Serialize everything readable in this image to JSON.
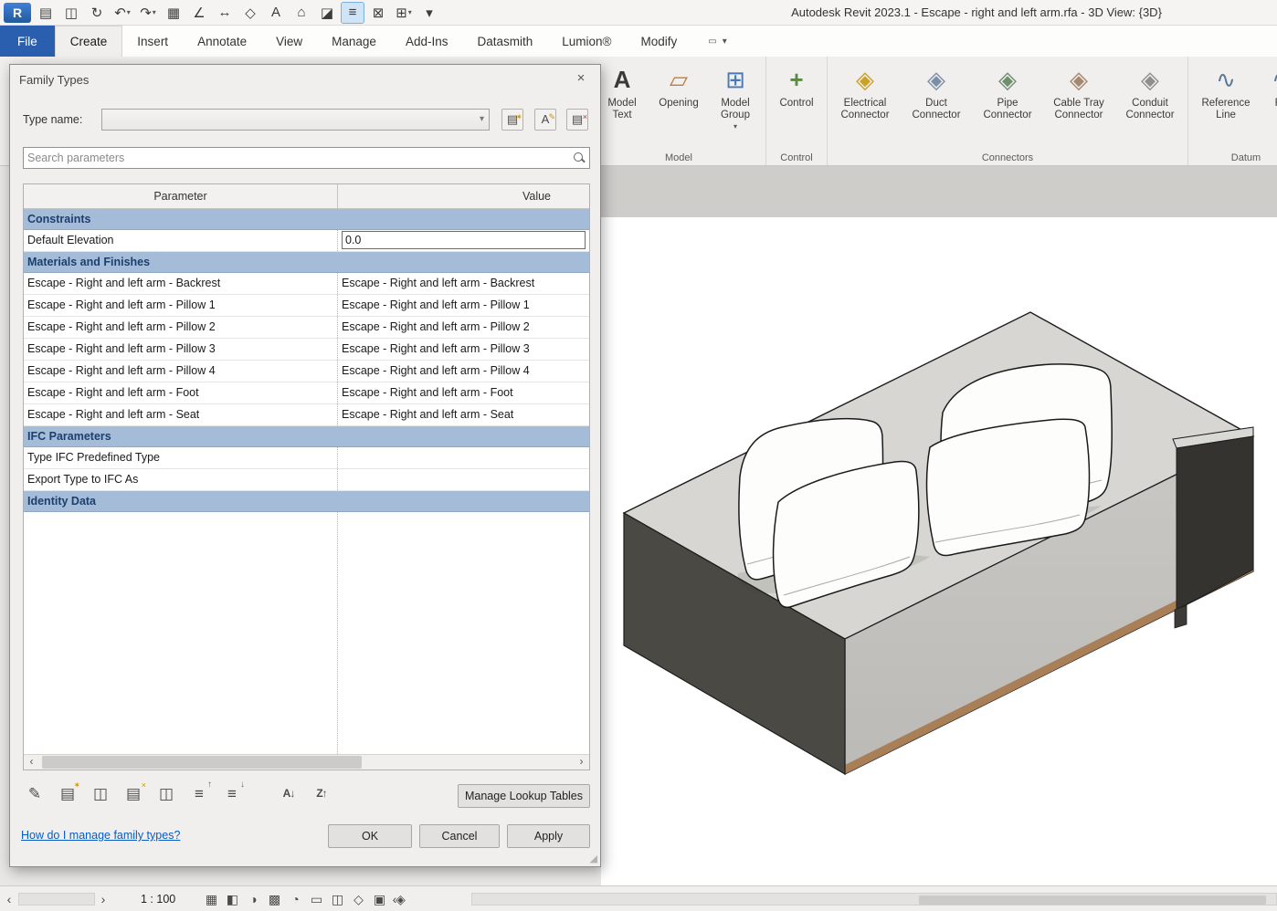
{
  "glyphs": {
    "caret": "▾",
    "chevron_left": "‹",
    "chevron_right": "›",
    "close": "×",
    "grip": "◢",
    "panel_toggle": "▭"
  },
  "title_bar": {
    "title": "Autodesk Revit 2023.1 - Escape - right and left arm.rfa - 3D View: {3D}"
  },
  "qat": {
    "items": [
      {
        "name": "revit-logo",
        "glyph": "R"
      },
      {
        "name": "open",
        "glyph": "▤"
      },
      {
        "name": "save",
        "glyph": "◫"
      },
      {
        "name": "sync",
        "glyph": "↻"
      },
      {
        "name": "undo",
        "glyph": "↶"
      },
      {
        "name": "redo",
        "glyph": "↷"
      },
      {
        "name": "print",
        "glyph": "▦"
      },
      {
        "name": "measure",
        "glyph": "∠"
      },
      {
        "name": "aligned-dimension",
        "glyph": "↔"
      },
      {
        "name": "tag",
        "glyph": "◇"
      },
      {
        "name": "text",
        "glyph": "A"
      },
      {
        "name": "default-3d-view",
        "glyph": "⌂"
      },
      {
        "name": "section",
        "glyph": "◪"
      },
      {
        "name": "thin-lines",
        "glyph": "≡"
      },
      {
        "name": "close-hidden-windows",
        "glyph": "⊠"
      },
      {
        "name": "switch-windows",
        "glyph": "⊞"
      },
      {
        "name": "customize-qat",
        "glyph": "▾"
      }
    ]
  },
  "ribbon": {
    "tabs": [
      "File",
      "Create",
      "Insert",
      "Annotate",
      "View",
      "Manage",
      "Add-Ins",
      "Datasmith",
      "Lumion®",
      "Modify"
    ],
    "active_tab": "Create",
    "panels": [
      {
        "label": "Model",
        "buttons": [
          {
            "label": "Model\nText",
            "icon": "A"
          },
          {
            "label": "Opening",
            "icon": "▱"
          },
          {
            "label": "Model\nGroup",
            "icon": "⊞"
          }
        ]
      },
      {
        "label": "Control",
        "buttons": [
          {
            "label": "Control",
            "icon": "+"
          }
        ]
      },
      {
        "label": "Connectors",
        "buttons": [
          {
            "label": "Electrical\nConnector",
            "icon": "◈"
          },
          {
            "label": "Duct\nConnector",
            "icon": "◈"
          },
          {
            "label": "Pipe\nConnector",
            "icon": "◈"
          },
          {
            "label": "Cable Tray\nConnector",
            "icon": "◈"
          },
          {
            "label": "Conduit\nConnector",
            "icon": "◈"
          }
        ]
      },
      {
        "label": "Datum",
        "buttons": [
          {
            "label": "Reference\nLine",
            "icon": "∿"
          },
          {
            "label": "Re",
            "icon": "∿"
          }
        ]
      }
    ]
  },
  "dialog": {
    "title": "Family Types",
    "type_name_label": "Type name:",
    "type_name_value": "",
    "type_buttons": [
      {
        "name": "new-type",
        "glyph": "▤",
        "overlay": "✶"
      },
      {
        "name": "rename-type",
        "glyph": "A",
        "overlay": "✎"
      },
      {
        "name": "delete-type",
        "glyph": "▤",
        "overlay": "×"
      }
    ],
    "search_placeholder": "Search parameters",
    "table": {
      "param_header": "Parameter",
      "value_header": "Value",
      "rows": [
        {
          "type": "group",
          "parameter": "Constraints"
        },
        {
          "type": "input",
          "parameter": "Default Elevation",
          "value": "0.0"
        },
        {
          "type": "group",
          "parameter": "Materials and Finishes"
        },
        {
          "type": "text",
          "parameter": "Escape - Right and left arm - Backrest",
          "value": "Escape - Right and left arm - Backrest"
        },
        {
          "type": "text",
          "parameter": "Escape - Right and left arm - Pillow 1",
          "value": "Escape - Right and left arm - Pillow 1"
        },
        {
          "type": "text",
          "parameter": "Escape - Right and left arm - Pillow 2",
          "value": "Escape - Right and left arm - Pillow 2"
        },
        {
          "type": "text",
          "parameter": "Escape - Right and left arm - Pillow 3",
          "value": "Escape - Right and left arm - Pillow 3"
        },
        {
          "type": "text",
          "parameter": "Escape - Right and left arm - Pillow 4",
          "value": "Escape - Right and left arm - Pillow 4"
        },
        {
          "type": "text",
          "parameter": "Escape - Right and left arm - Foot",
          "value": "Escape - Right and left arm - Foot"
        },
        {
          "type": "text",
          "parameter": "Escape - Right and left arm - Seat",
          "value": "Escape - Right and left arm - Seat"
        },
        {
          "type": "group",
          "parameter": "IFC Parameters"
        },
        {
          "type": "text",
          "parameter": "Type IFC Predefined Type",
          "value": ""
        },
        {
          "type": "text",
          "parameter": "Export Type to IFC As",
          "value": ""
        },
        {
          "type": "group",
          "parameter": "Identity Data"
        }
      ]
    },
    "toolbar_icons": [
      {
        "name": "edit-parameter",
        "glyph": "✎",
        "overlay": ""
      },
      {
        "name": "new-parameter",
        "glyph": "▤",
        "overlay": "✶"
      },
      {
        "name": "duplicate-parameter",
        "glyph": "◫",
        "overlay": ""
      },
      {
        "name": "delete-parameter",
        "glyph": "▤",
        "overlay": "×"
      },
      {
        "name": "copy-parameter",
        "glyph": "◫",
        "overlay": ""
      },
      {
        "name": "move-parameter-up",
        "glyph": "≡",
        "overlay": "↑"
      },
      {
        "name": "move-parameter-down",
        "glyph": "≡",
        "overlay": "↓"
      },
      {
        "name": "sort-ascending",
        "glyph": "A↓",
        "overlay": ""
      },
      {
        "name": "sort-descending",
        "glyph": "Z↑",
        "overlay": ""
      }
    ],
    "manage_lookup_label": "Manage Lookup Tables",
    "help_link": "How do I manage family types?",
    "buttons": {
      "ok": "OK",
      "cancel": "Cancel",
      "apply": "Apply"
    }
  },
  "status_bar": {
    "scale_label": "1 : 100",
    "icons": [
      {
        "name": "detail-level",
        "glyph": "▦"
      },
      {
        "name": "visual-style",
        "glyph": "◧"
      },
      {
        "name": "sun-path",
        "glyph": "◑"
      },
      {
        "name": "shadows",
        "glyph": "▩"
      },
      {
        "name": "rendering",
        "glyph": "◔"
      },
      {
        "name": "crop-view",
        "glyph": "▭"
      },
      {
        "name": "show-crop-region",
        "glyph": "◫"
      },
      {
        "name": "lock-3d-view",
        "glyph": "◇"
      },
      {
        "name": "temporary-hide-isolate",
        "glyph": "▣"
      },
      {
        "name": "reveal-hidden-elements",
        "glyph": "◈"
      }
    ]
  },
  "colors": {
    "file_tab": "#2a5fb0",
    "group_header_bg": "#a4bcd8",
    "link": "#0b5bc4",
    "qat_active_bg": "#cfe4f7"
  }
}
